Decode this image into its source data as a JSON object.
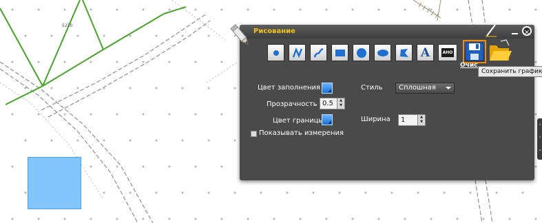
{
  "map": {
    "parcel_number": "5210",
    "polygon_fill": "#82c6fb",
    "line_color": "#4aa02c"
  },
  "panel": {
    "title": "Рисование",
    "title_color": "#f2c21a",
    "tools": [
      {
        "icon": "point-icon"
      },
      {
        "icon": "polyline-icon"
      },
      {
        "icon": "freehand-line-icon"
      },
      {
        "icon": "rectangle-icon"
      },
      {
        "icon": "circle-icon"
      },
      {
        "icon": "ellipse-icon"
      },
      {
        "icon": "freehand-polygon-icon"
      },
      {
        "icon": "text-icon",
        "label": "A"
      },
      {
        "icon": "label-icon",
        "label": "AHO"
      }
    ],
    "save_tooltip": "Сохранить графику",
    "clear_label": "Очистить",
    "fill_color_label": "Цвет заполнения",
    "transparency_label": "Прозрачность",
    "transparency_value": "0.5",
    "border_color_label": "Цвет границы",
    "style_label": "Стиль",
    "style_value": "Сплошная",
    "width_label": "Ширина",
    "width_value": "1",
    "show_measurements_label": "Показывать измерения",
    "fill_color": "#2f8ef0",
    "border_color": "#2f8ef0"
  }
}
